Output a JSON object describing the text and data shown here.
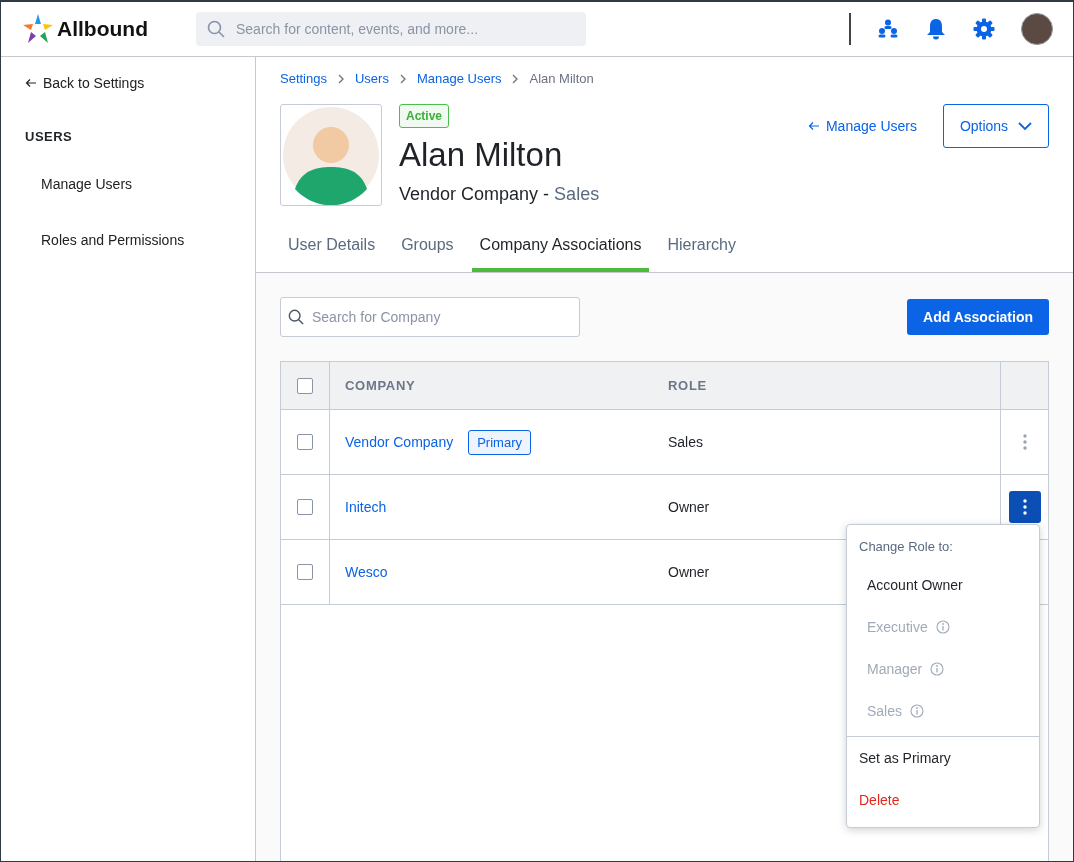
{
  "header": {
    "logo": "Allbound",
    "search": {
      "placeholder": "Search for content, events, and more..."
    }
  },
  "sidebar": {
    "back": "Back to Settings",
    "section": "USERS",
    "items": [
      {
        "label": "Manage Users",
        "selected": false
      },
      {
        "label": "Roles and Permissions",
        "selected": false
      }
    ]
  },
  "breadcrumbs": [
    {
      "label": "Settings",
      "link": true
    },
    {
      "label": "Users",
      "link": true
    },
    {
      "label": "Manage Users",
      "link": true
    },
    {
      "label": "Alan Milton",
      "link": false
    }
  ],
  "profile": {
    "status": "Active",
    "name": "Alan Milton",
    "company": "Vendor Company -",
    "role": "Sales",
    "back_link": "Manage Users",
    "options": "Options"
  },
  "tabs": [
    {
      "label": "User Details",
      "selected": false
    },
    {
      "label": "Groups",
      "selected": false
    },
    {
      "label": "Company Associations",
      "selected": true
    },
    {
      "label": "Hierarchy",
      "selected": false
    }
  ],
  "company_search": {
    "placeholder": "Search for Company"
  },
  "add_button": "Add Association",
  "table": {
    "select_all": {
      "checked": false
    },
    "columns": [
      "COMPANY",
      "ROLE"
    ],
    "rows": [
      {
        "company": "Vendor Company",
        "badge": "Primary",
        "role": "Sales",
        "checked": false,
        "menu_open": false
      },
      {
        "company": "Initech",
        "role": "Owner",
        "checked": false,
        "menu_open": true
      },
      {
        "company": "Wesco",
        "role": "Owner",
        "checked": false
      }
    ]
  },
  "menu": {
    "title": "Change Role to:",
    "roles": [
      {
        "label": "Account Owner",
        "disabled": false
      },
      {
        "label": "Executive",
        "disabled": true
      },
      {
        "label": "Manager",
        "disabled": true
      },
      {
        "label": "Sales",
        "disabled": true
      }
    ],
    "actions": [
      {
        "label": "Set as Primary",
        "kind": "normal"
      },
      {
        "label": "Delete",
        "kind": "danger"
      }
    ]
  }
}
